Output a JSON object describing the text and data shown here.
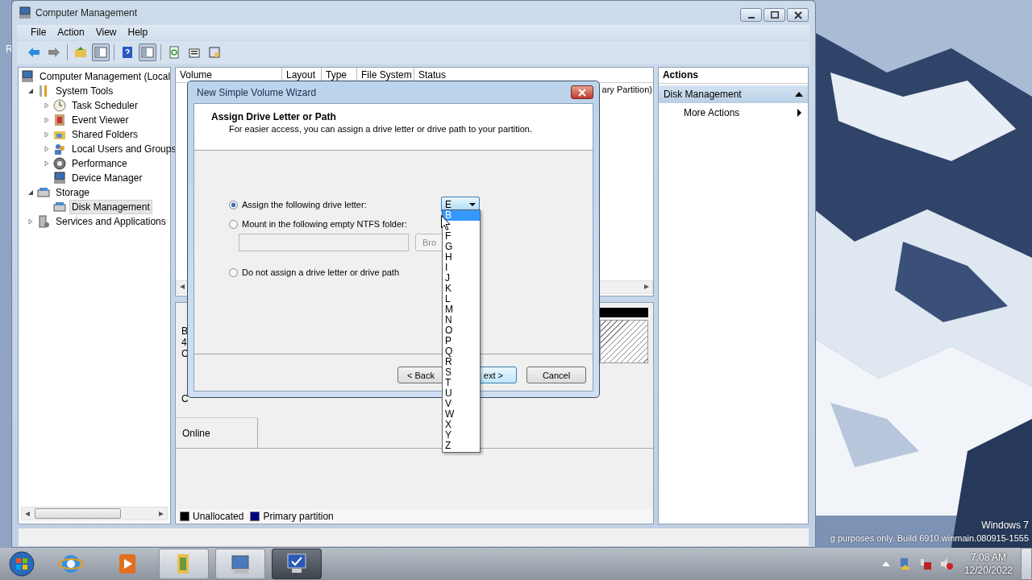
{
  "desktop": {
    "icon_fragment": "R",
    "watermark": [
      "Windows 7",
      "g purposes only. Build 6910.winmain.080915-1555"
    ]
  },
  "window": {
    "title": "Computer Management"
  },
  "menu": [
    "File",
    "Action",
    "View",
    "Help"
  ],
  "toolbar": [
    {
      "pressed": false
    },
    {
      "pressed": false
    },
    {
      "pressed": false
    },
    {
      "pressed": true
    },
    {
      "pressed": false
    },
    {
      "pressed": true
    },
    {
      "pressed": false
    },
    {
      "pressed": false
    },
    {
      "pressed": false
    }
  ],
  "tree": [
    {
      "label": "Computer Management (Local",
      "selected": false,
      "children": [
        {
          "label": "System Tools",
          "expanded": true,
          "selected": false,
          "children": [
            {
              "label": "Task Scheduler",
              "expanded": false,
              "selected": false
            },
            {
              "label": "Event Viewer",
              "expanded": false,
              "selected": false
            },
            {
              "label": "Shared Folders",
              "expanded": false,
              "selected": false
            },
            {
              "label": "Local Users and Groups",
              "expanded": false,
              "selected": false
            },
            {
              "label": "Performance",
              "expanded": false,
              "selected": false
            },
            {
              "label": "Device Manager",
              "selected": false
            }
          ]
        },
        {
          "label": "Storage",
          "expanded": true,
          "selected": false,
          "children": [
            {
              "label": "Disk Management",
              "selected": true
            }
          ]
        },
        {
          "label": "Services and Applications",
          "expanded": false,
          "selected": false
        }
      ]
    }
  ],
  "volume_table": {
    "columns": [
      "Volume",
      "Layout",
      "Type",
      "File System",
      "Status"
    ],
    "status_cell": "ary Partition)"
  },
  "disks": [
    {
      "label_lines": [
        "B",
        "4",
        "C"
      ]
    },
    {
      "label_lines": [
        "C"
      ],
      "status": "Online"
    }
  ],
  "legend": [
    {
      "label": "Unallocated",
      "color": "#000000"
    },
    {
      "label": "Primary partition",
      "color": "#000080"
    }
  ],
  "actions": {
    "title": "Actions",
    "section": {
      "label": "Disk Management",
      "expanded": true
    },
    "items": [
      "More Actions"
    ]
  },
  "dialog": {
    "title": "New Simple Volume Wizard",
    "heading": "Assign Drive Letter or Path",
    "subtitle": "For easier access, you can assign a drive letter or drive path to your partition.",
    "options": [
      {
        "label": "Assign the following drive letter:",
        "selected": true
      },
      {
        "label": "Mount in the following empty NTFS folder:",
        "selected": false
      },
      {
        "label": "Do not assign a drive letter or drive path",
        "selected": false
      }
    ],
    "drive_letter": "E",
    "folder_field": {
      "disabled": true
    },
    "browse_button": "Bro",
    "buttons": [
      "< Back",
      "ext >",
      "Cancel"
    ],
    "dropdown": {
      "items": [
        {
          "label": "B",
          "selected": true
        },
        {
          "label": "F",
          "selected": false
        },
        {
          "label": "G",
          "selected": false
        },
        {
          "label": "H",
          "selected": false
        },
        {
          "label": "I",
          "selected": false
        },
        {
          "label": "J",
          "selected": false
        },
        {
          "label": "K",
          "selected": false
        },
        {
          "label": "L",
          "selected": false
        },
        {
          "label": "M",
          "selected": false
        },
        {
          "label": "N",
          "selected": false
        },
        {
          "label": "O",
          "selected": false
        },
        {
          "label": "P",
          "selected": false
        },
        {
          "label": "Q",
          "selected": false
        },
        {
          "label": "R",
          "selected": false
        },
        {
          "label": "S",
          "selected": false
        },
        {
          "label": "T",
          "selected": false
        },
        {
          "label": "U",
          "selected": false
        },
        {
          "label": "V",
          "selected": false
        },
        {
          "label": "W",
          "selected": false
        },
        {
          "label": "X",
          "selected": false
        },
        {
          "label": "Y",
          "selected": false
        },
        {
          "label": "Z",
          "selected": false
        }
      ]
    }
  },
  "taskbar": {
    "apps": [
      {
        "open": false,
        "selected": false
      },
      {
        "open": false,
        "selected": false
      },
      {
        "open": false,
        "selected": false
      },
      {
        "open": true,
        "selected": false
      },
      {
        "open": true,
        "selected": false
      },
      {
        "open": true,
        "selected": true
      }
    ],
    "clock": {
      "time": "7:08 AM",
      "date": "12/20/2022"
    }
  }
}
